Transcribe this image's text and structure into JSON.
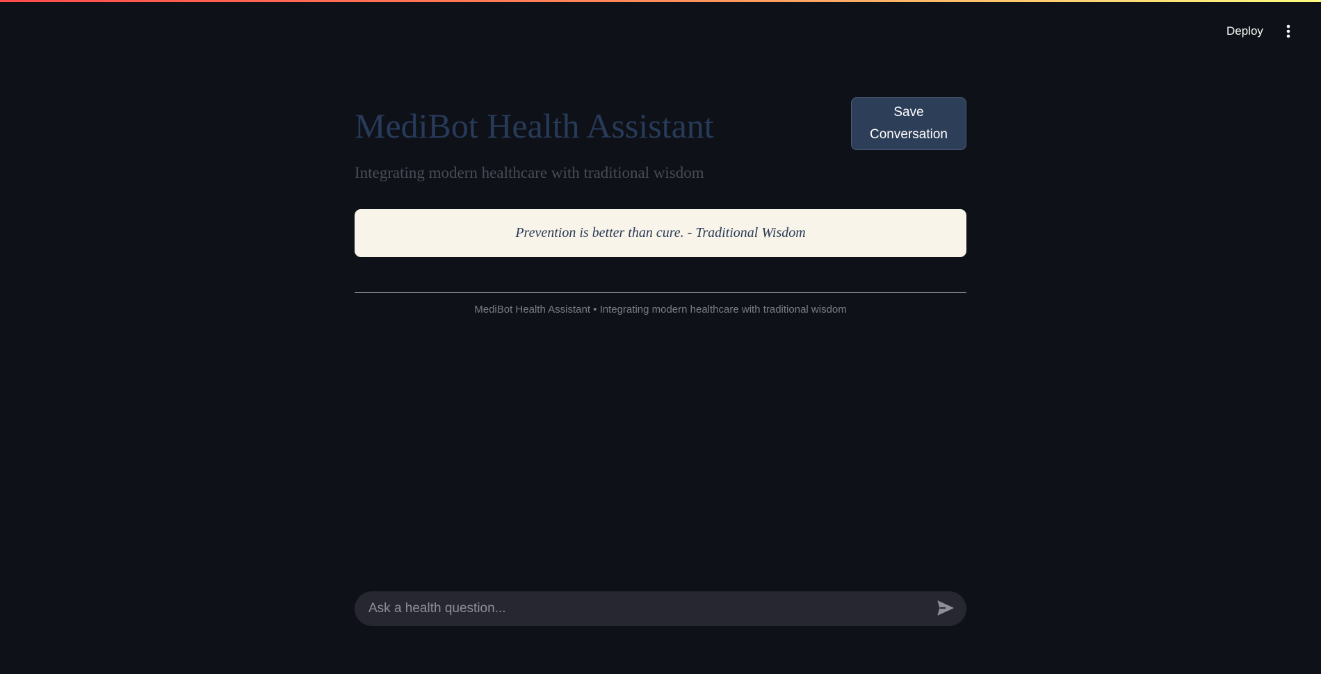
{
  "header": {
    "deploy_label": "Deploy",
    "menu_icon": "vertical-ellipsis-icon"
  },
  "main": {
    "title": "MediBot Health Assistant",
    "subtitle": "Integrating modern healthcare with traditional wisdom",
    "save_button_label": "Save Conversation",
    "quote": "Prevention is better than cure. - Traditional Wisdom",
    "footer": "MediBot Health Assistant • Integrating modern healthcare with traditional wisdom"
  },
  "chat": {
    "placeholder": "Ask a health question...",
    "value": "",
    "send_icon": "send-icon"
  },
  "colors": {
    "background": "#0e1117",
    "title": "#283a5a",
    "save_button": "#2d3e59",
    "quote_background": "#f8f4ea",
    "input_background": "#262730"
  }
}
